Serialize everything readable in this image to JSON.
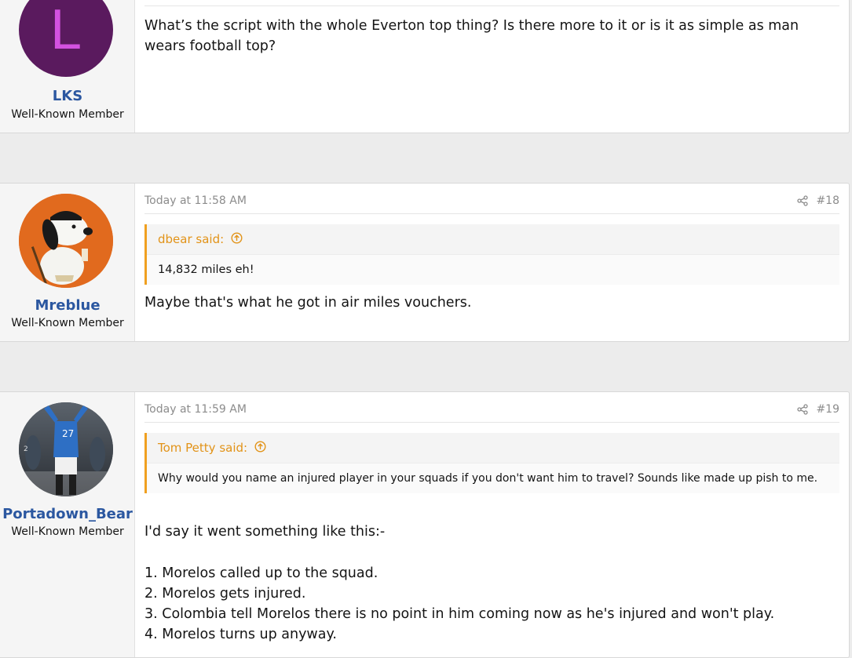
{
  "posts": [
    {
      "username": "LKS",
      "user_title": "Well-Known Member",
      "avatar_letter": "L",
      "avatar_color": "#5a1a5e",
      "avatar_letter_color": "#d352e0",
      "message": "What’s the script with the whole Everton top thing? Is there more to it or is it as simple as man wears football top?"
    },
    {
      "username": "Mreblue",
      "user_title": "Well-Known Member",
      "date": "Today at 11:58 AM",
      "share_icon": "share-icon",
      "post_number": "#18",
      "quote_author": "dbear said:",
      "quote_text": "14,832 miles eh!",
      "message": "Maybe that's what he got in air miles vouchers."
    },
    {
      "username": "Portadown_Bear",
      "user_title": "Well-Known Member",
      "date": "Today at 11:59 AM",
      "share_icon": "share-icon",
      "post_number": "#19",
      "quote_author": "Tom Petty said:",
      "quote_text": "Why would you name an injured player in your squads if you don't want him to travel? Sounds like made up pish to me.",
      "message_intro": "I'd say it went something like this:-",
      "message_list": [
        "1. Morelos called up to the squad.",
        "2. Morelos gets injured.",
        "3. Colombia tell Morelos there is no point in him coming now as he's injured and won't play.",
        "4. Morelos turns up anyway."
      ]
    }
  ],
  "colors": {
    "username": "#2b57a0",
    "quote_accent": "#f0a020",
    "quote_author": "#e29318"
  }
}
